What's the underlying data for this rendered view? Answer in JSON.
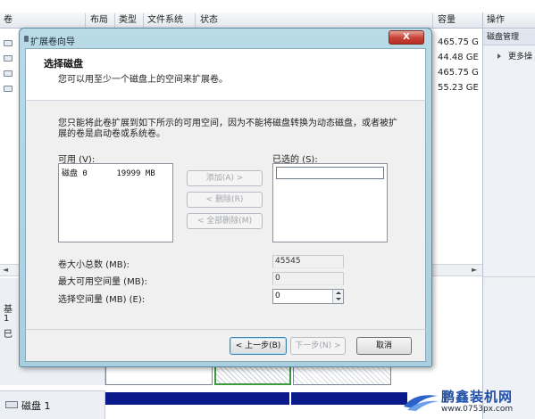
{
  "background": {
    "columns": [
      "卷",
      "布局",
      "类型",
      "文件系统",
      "状态",
      "容量"
    ],
    "capacities": [
      "465.75 G",
      "44.48 GE",
      "465.75 G",
      "55.23 GE"
    ],
    "left_strip_chars": [
      "基",
      "1",
      "巳"
    ],
    "disk1_label": "磁盘 1"
  },
  "actions_panel": {
    "header": "操作",
    "sub": "磁盘管理",
    "more": "更多操"
  },
  "wizard": {
    "title": "扩展卷向导",
    "close_label": "X",
    "header_title": "选择磁盘",
    "header_subtitle": "您可以用至少一个磁盘上的空间来扩展卷。",
    "description": "您只能将此卷扩展到如下所示的可用空间，因为不能将磁盘转换为动态磁盘，或者被扩展的卷是启动卷或系统卷。",
    "available_label": "可用 (V):",
    "available_items": [
      "磁盘 0      19999 MB"
    ],
    "selected_label": "已选的 (S):",
    "add_button": "添加(A) >",
    "remove_button": "< 删除(R)",
    "remove_all_button": "< 全部删除(M)",
    "total_size_label": "卷大小总数 (MB):",
    "total_size_value": "45545",
    "max_space_label": "最大可用空间量 (MB):",
    "max_space_value": "0",
    "select_space_label": "选择空间量 (MB) (E):",
    "select_space_value": "0",
    "back_button": "< 上一步(B)",
    "next_button": "下一步(N) >",
    "cancel_button": "取消"
  },
  "watermark": {
    "name": "鹏鑫装机网",
    "url": "www.0753px.com"
  }
}
